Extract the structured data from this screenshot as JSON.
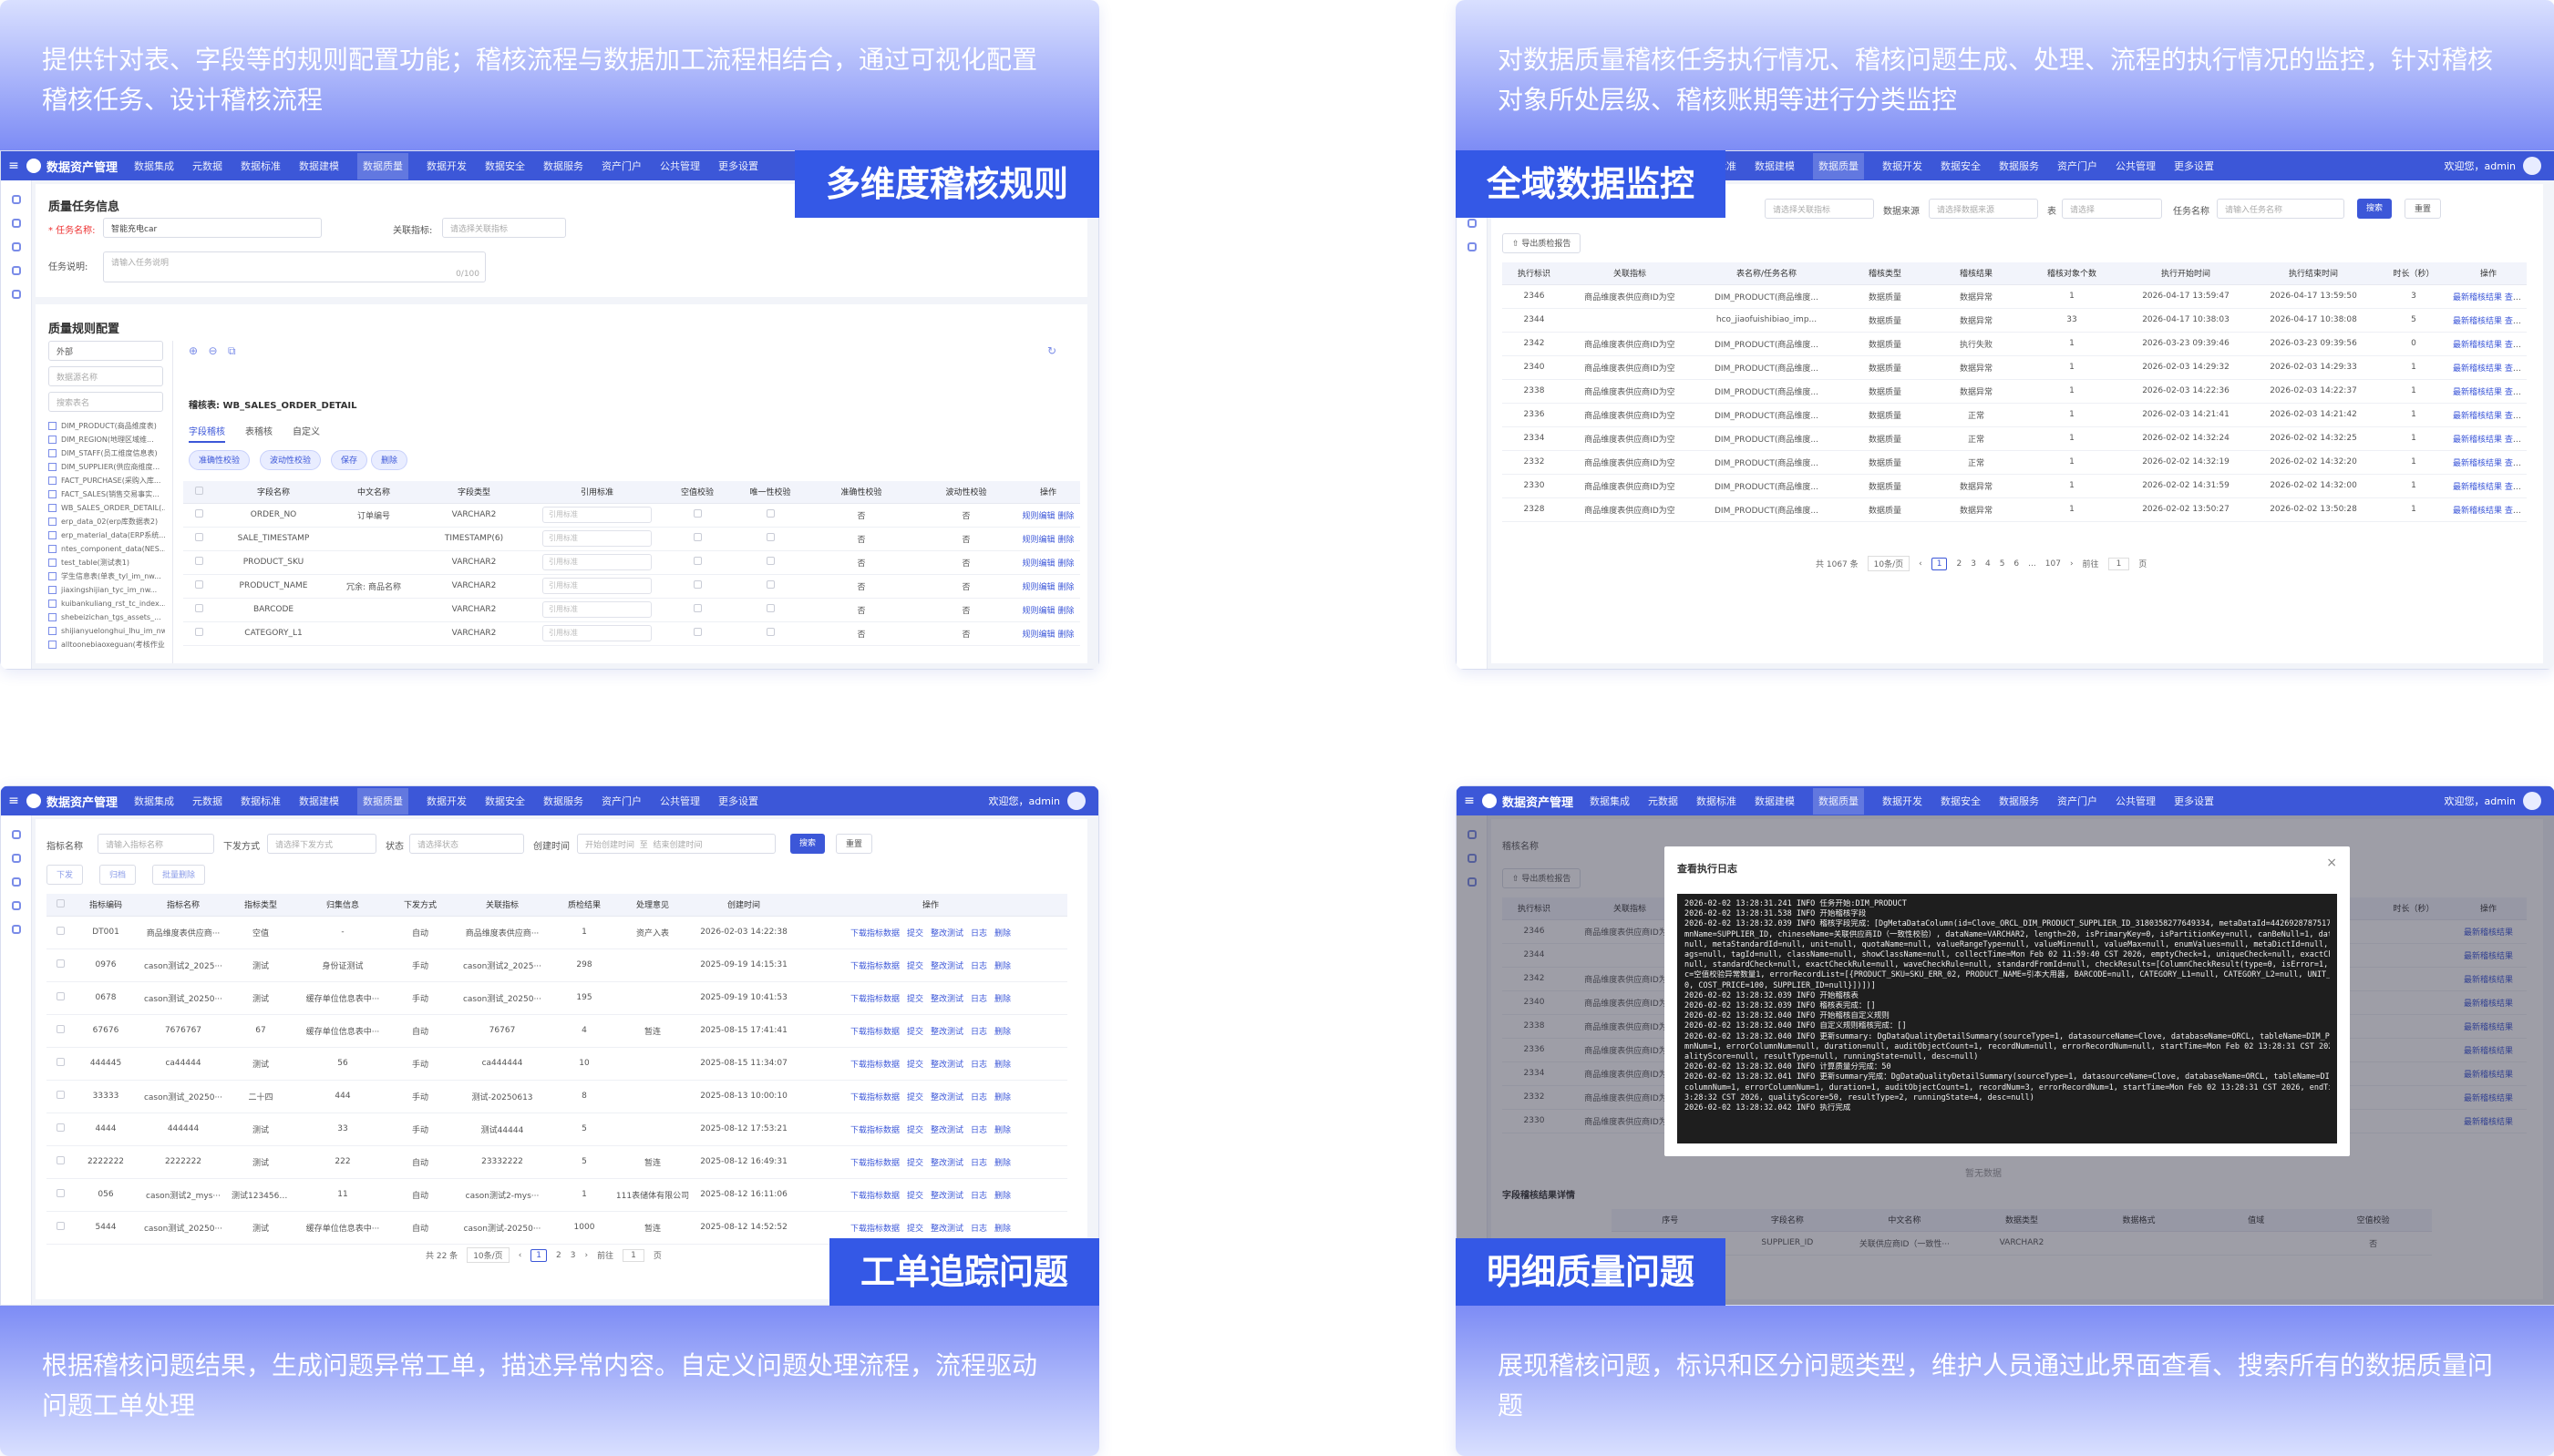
{
  "panels": {
    "rules": {
      "caption": "提供针对表、字段等的规则配置功能；稽核流程与数据加工流程相结合，通过可视化配置稽核任务、设计稽核流程",
      "caption_line1": "提供针对表、字段等的规则配置功能；稽核流程与数据加工流程相结合，通过可视化配置",
      "caption_line2": "稽核任务、设计稽核流程",
      "badge": "多维度稽核规则"
    },
    "monitor": {
      "caption_line1": "对数据质量稽核任务执行情况、稽核问题生成、处理、流程的执行情况的监控，针对稽核",
      "caption_line2": "对象所处层级、稽核账期等进行分类监控",
      "badge": "全域数据监控"
    },
    "tickets": {
      "caption_line1": "根据稽核问题结果，生成问题异常工单，描述异常内容。自定义问题处理流程，流程驱动",
      "caption_line2": "问题工单处理",
      "badge": "工单追踪问题"
    },
    "detail": {
      "caption_line1": "展现稽核问题，标识和区分问题类型，维护人员通过此界面查看、搜索所有的数据质量问",
      "caption_line2": "题",
      "badge": "明细质量问题"
    }
  },
  "app": {
    "name": "数据资产管理",
    "nav": [
      "数据集成",
      "元数据",
      "数据标准",
      "数据建模",
      "数据质量",
      "数据开发",
      "数据安全",
      "数据服务",
      "资产门户",
      "公共管理",
      "更多设置"
    ],
    "active_nav": "数据质量",
    "user": "欢迎您，admin"
  },
  "rules_screen": {
    "section_task": "质量任务信息",
    "task_name_label": "* 任务名称:",
    "task_name_value": "智能充电car",
    "related_label": "关联指标:",
    "related_placeholder": "请选择关联指标",
    "desc_label": "任务说明:",
    "desc_placeholder": "请输入任务说明",
    "desc_count": "0/100",
    "section_config": "质量规则配置",
    "source_select": "外部",
    "db_placeholder": "数据源名称",
    "search_placeholder": "搜索表名",
    "tree": [
      "DIM_PRODUCT(商品维度表)",
      "DIM_REGION(地理区域维...",
      "DIM_STAFF(员工维度信息表)",
      "DIM_SUPPLIER(供应商维度...",
      "FACT_PURCHASE(采购入库...",
      "FACT_SALES(销售交易事实...",
      "WB_SALES_ORDER_DETAIL(...",
      "erp_data_02(erp库数据表2)",
      "erp_material_data(ERP系统...",
      "ntes_component_data(NES...",
      "test_table(测试表1)",
      "学生信息表(单表_tyl_im_nw...",
      "jiaxingshijian_tyc_im_nw...",
      "kuibankuliang_rst_tc_index...",
      "shebeizichan_tgs_assets_...",
      "shijianyuelonghui_lhu_im_nw...",
      "alltoonebiaoxeguan(考核作业..."
    ],
    "table_label": "稽核表: WB_SALES_ORDER_DETAIL",
    "tabs": [
      "字段稽核",
      "表稽核",
      "自定义"
    ],
    "buttons": [
      "准确性校验",
      "波动性校验",
      "保存",
      "删除"
    ],
    "columns": [
      "",
      "字段名称",
      "中文名称",
      "字段类型",
      "引用标准",
      "空值校验",
      "唯一性校验",
      "准确性校验",
      "波动性校验",
      "操作"
    ],
    "rows": [
      [
        "ORDER_NO",
        "订单编号",
        "VARCHAR2",
        "否",
        "否"
      ],
      [
        "SALE_TIMESTAMP",
        "",
        "TIMESTAMP(6)",
        "否",
        "否"
      ],
      [
        "PRODUCT_SKU",
        "",
        "VARCHAR2",
        "否",
        "否"
      ],
      [
        "PRODUCT_NAME",
        "冗余: 商品名称",
        "VARCHAR2",
        "否",
        "否"
      ],
      [
        "BARCODE",
        "",
        "VARCHAR2",
        "否",
        "否"
      ],
      [
        "CATEGORY_L1",
        "",
        "VARCHAR2",
        "否",
        "否"
      ]
    ],
    "std_placeholder": "引用标准",
    "op_edit": "规则编辑",
    "op_delete": "删除"
  },
  "monitor_screen": {
    "filters": {
      "metric_placeholder": "请选择关联指标",
      "source_label": "数据来源",
      "source_placeholder": "请选择数据来源",
      "table_label": "表",
      "table_placeholder": "请选择",
      "task_label": "任务名称",
      "task_placeholder": "请输入任务名称",
      "search": "搜索",
      "reset": "重置"
    },
    "export": "导出质检报告",
    "columns": [
      "执行标识",
      "关联指标",
      "表名称/任务名称",
      "稽核类型",
      "稽核结果",
      "稽核对象个数",
      "执行开始时间",
      "执行结束时间",
      "时长（秒）",
      "操作"
    ],
    "rows": [
      [
        "2346",
        "商品维度表供应商ID为空",
        "DIM_PRODUCT(商品维度...",
        "数据质量",
        "数据异常",
        "1",
        "2026-04-17 13:59:47",
        "2026-04-17 13:59:50",
        "3"
      ],
      [
        "2344",
        "",
        "hco_jiaofuishibiao_imp...",
        "数据质量",
        "数据异常",
        "33",
        "2026-04-17 10:38:03",
        "2026-04-17 10:38:08",
        "5"
      ],
      [
        "2342",
        "商品维度表供应商ID为空",
        "DIM_PRODUCT(商品维度...",
        "数据质量",
        "执行失败",
        "1",
        "2026-03-23 09:39:46",
        "2026-03-23 09:39:56",
        "0"
      ],
      [
        "2340",
        "商品维度表供应商ID为空",
        "DIM_PRODUCT(商品维度...",
        "数据质量",
        "数据异常",
        "1",
        "2026-02-03 14:29:32",
        "2026-02-03 14:29:33",
        "1"
      ],
      [
        "2338",
        "商品维度表供应商ID为空",
        "DIM_PRODUCT(商品维度...",
        "数据质量",
        "数据异常",
        "1",
        "2026-02-03 14:22:36",
        "2026-02-03 14:22:37",
        "1"
      ],
      [
        "2336",
        "商品维度表供应商ID为空",
        "DIM_PRODUCT(商品维度...",
        "数据质量",
        "正常",
        "1",
        "2026-02-03 14:21:41",
        "2026-02-03 14:21:42",
        "1"
      ],
      [
        "2334",
        "商品维度表供应商ID为空",
        "DIM_PRODUCT(商品维度...",
        "数据质量",
        "正常",
        "1",
        "2026-02-02 14:32:24",
        "2026-02-02 14:32:25",
        "1"
      ],
      [
        "2332",
        "商品维度表供应商ID为空",
        "DIM_PRODUCT(商品维度...",
        "数据质量",
        "正常",
        "1",
        "2026-02-02 14:32:19",
        "2026-02-02 14:32:20",
        "1"
      ],
      [
        "2330",
        "商品维度表供应商ID为空",
        "DIM_PRODUCT(商品维度...",
        "数据质量",
        "数据异常",
        "1",
        "2026-02-02 14:31:59",
        "2026-02-02 14:32:00",
        "1"
      ],
      [
        "2328",
        "商品维度表供应商ID为空",
        "DIM_PRODUCT(商品维度...",
        "数据质量",
        "数据异常",
        "1",
        "2026-02-02 13:50:27",
        "2026-02-02 13:50:28",
        "1"
      ]
    ],
    "op_latest": "最新稽核结果",
    "op_history": "查看历史",
    "pager": {
      "total": "共 1067 条",
      "size": "10条/页",
      "pages": [
        "1",
        "2",
        "3",
        "4",
        "5",
        "6",
        "...",
        "107"
      ],
      "goto": "前往",
      "goto_val": "1",
      "page": "页"
    }
  },
  "tickets_screen": {
    "filters": {
      "name_label": "指标名称",
      "name_placeholder": "请输入指标名称",
      "mode_label": "下发方式",
      "mode_placeholder": "请选择下发方式",
      "status_label": "状态",
      "status_placeholder": "请选择状态",
      "time_label": "创建时间",
      "start_placeholder": "开始创建时间",
      "to": "至",
      "end_placeholder": "结束创建时间",
      "search": "搜索",
      "reset": "重置"
    },
    "actions": [
      "下发",
      "归档",
      "批量删除"
    ],
    "columns": [
      "",
      "指标编码",
      "指标名称",
      "指标类型",
      "归集信息",
      "下发方式",
      "关联指标",
      "质检结果",
      "处理意见",
      "创建时间",
      "操作"
    ],
    "rows": [
      [
        "DT001",
        "商品维度表供应商···",
        "空值",
        "-",
        "自动",
        "商品维度表供应商···",
        "1",
        "资产入表",
        "2026-02-03 14:22:38"
      ],
      [
        "0976",
        "cason测试2_2025···",
        "测试",
        "身份证测试",
        "手动",
        "cason测试2_2025···",
        "298",
        "",
        "2025-09-19 14:15:31"
      ],
      [
        "0678",
        "cason测试_20250···",
        "测试",
        "缓存单位信息表中···",
        "手动",
        "cason测试_20250···",
        "195",
        "",
        "2025-09-19 10:41:53"
      ],
      [
        "67676",
        "7676767",
        "67",
        "缓存单位信息表中···",
        "自动",
        "76767",
        "4",
        "暂连",
        "2025-08-15 17:41:41"
      ],
      [
        "444445",
        "ca44444",
        "测试",
        "56",
        "手动",
        "ca444444",
        "10",
        "",
        "2025-08-15 11:34:07"
      ],
      [
        "33333",
        "cason测试_20250···",
        "二十四",
        "444",
        "手动",
        "测试-20250613",
        "8",
        "",
        "2025-08-13 10:00:10"
      ],
      [
        "4444",
        "444444",
        "测试",
        "33",
        "手动",
        "测试44444",
        "5",
        "",
        "2025-08-12 17:53:21"
      ],
      [
        "2222222",
        "2222222",
        "测试",
        "222",
        "自动",
        "23332222",
        "5",
        "暂连",
        "2025-08-12 16:49:31"
      ],
      [
        "056",
        "cason测试2_mys···",
        "测试1234567890···",
        "11",
        "自动",
        "cason测试2-mys···",
        "1",
        "111表储体有限公司",
        "2025-08-12 16:11:06"
      ],
      [
        "5444",
        "cason测试_20250···",
        "测试",
        "缓存单位信息表中···",
        "自动",
        "cason测试-20250···",
        "1000",
        "暂连",
        "2025-08-12 14:52:52"
      ]
    ],
    "ops": [
      "下载指标数据",
      "提交",
      "整改测试",
      "日志",
      "删除"
    ],
    "pager": {
      "total": "共 22 条",
      "size": "10条/页",
      "pages": [
        "1",
        "2",
        "3"
      ],
      "goto": "前往",
      "goto_val": "1",
      "page": "页"
    }
  },
  "detail_screen": {
    "modal_title": "查看执行日志",
    "close": "×",
    "log": [
      "2026-02-02 13:28:31.241 INFO 任务开始:DIM_PRODUCT",
      "2026-02-02 13:28:31.538 INFO 开始稽核字段",
      "2026-02-02 13:28:32.039 INFO 稽核字段完成：[DgMetaDataColumn(id=Clove_ORCL_DIM_PRODUCT_SUPPLIER_ID_3180358277649334, metaDataId=4426928787517440, colu",
      "mnName=SUPPLIER_ID, chineseName=关联供应商ID（一致性校验）, dataName=VARCHAR2, length=20, isPrimaryKey=0, isPartitionKey=null, canBeNull=1, datasourceType=",
      "null, metaStandardId=null, unit=null, quotaName=null, valueRangeType=null, valueMin=null, valueMax=null, enumValues=null, metaDictId=null, level=null, tags=null, showT",
      "ags=null, tagId=null, className=null, showClassName=null, collectTime=Mon Feb 02 11:59:40 CST 2026, emptyCheck=1, uniqueCheck=null, exactCheck=null, waveCheck=",
      "null, standardCheck=null, exactCheckRule=null, waveCheckRule=null, standardFromId=null, checkResults=[ColumnCheckResult(type=0, isError=1, errorCount=1, totalCount=3, des",
      "c=空值校验异常数量1, errorRecordList=[{PRODUCT_SKU=SKU_ERR_02, PRODUCT_NAME=引本大用器, BARCODE=null, CATEGORY_L1=null, CATEGORY_L2=null, UNIT_PRICE=1",
      "0, COST_PRICE=100, SUPPLIER_ID=null}])])]",
      "2026-02-02 13:28:32.039 INFO 开始稽核表",
      "2026-02-02 13:28:32.039 INFO 稽核表完成：[]",
      "2026-02-02 13:28:32.040 INFO 开始稽核自定义规则",
      "2026-02-02 13:28:32.040 INFO 自定义规则稽核完成：[]",
      "2026-02-02 13:28:32.040 INFO 更新summary: DgDataQualityDetailSummary(sourceType=1, datasourceName=Clove, databaseName=ORCL, tableName=DIM_PRODUCT, colu",
      "mnNum=1, errorColumnNum=null, duration=null, auditObjectCount=1, recordNum=null, errorRecordNum=null, startTime=Mon Feb 02 13:28:31 CST 2026, endTime=null, qu",
      "alityScore=null, resultType=null, runningState=null, desc=null)",
      "2026-02-02 13:28:32.040 INFO 计算质量分完成：50",
      "2026-02-02 13:28:32.041 INFO 更新summary完成：DgDataQualityDetailSummary(sourceType=1, datasourceName=Clove, databaseName=ORCL, tableName=DIM_PRODUCT,",
      "columnNum=1, errorColumnNum=1, duration=1, auditObjectCount=1, recordNum=3, errorRecordNum=1, startTime=Mon Feb 02 13:28:31 CST 2026, endTime=Mon Feb 02 1",
      "3:28:32 CST 2026, qualityScore=50, resultType=2, runningState=4, desc=null)",
      "2026-02-02 13:28:32.042 INFO 执行完成"
    ],
    "bg_export": "导出质检报告",
    "bg_task_label": "稽核名称",
    "bg_section": "字段稽核结果详情",
    "bg_columns": [
      "序号",
      "字段名称",
      "中文名称",
      "数据类型",
      "数据格式",
      "值域",
      "空值校验"
    ],
    "bg_row": [
      "1",
      "SUPPLIER_ID",
      "关联供应商ID（一致性···",
      "VARCHAR2",
      "",
      "",
      "否"
    ],
    "bg_nodata": "暂无数据"
  }
}
